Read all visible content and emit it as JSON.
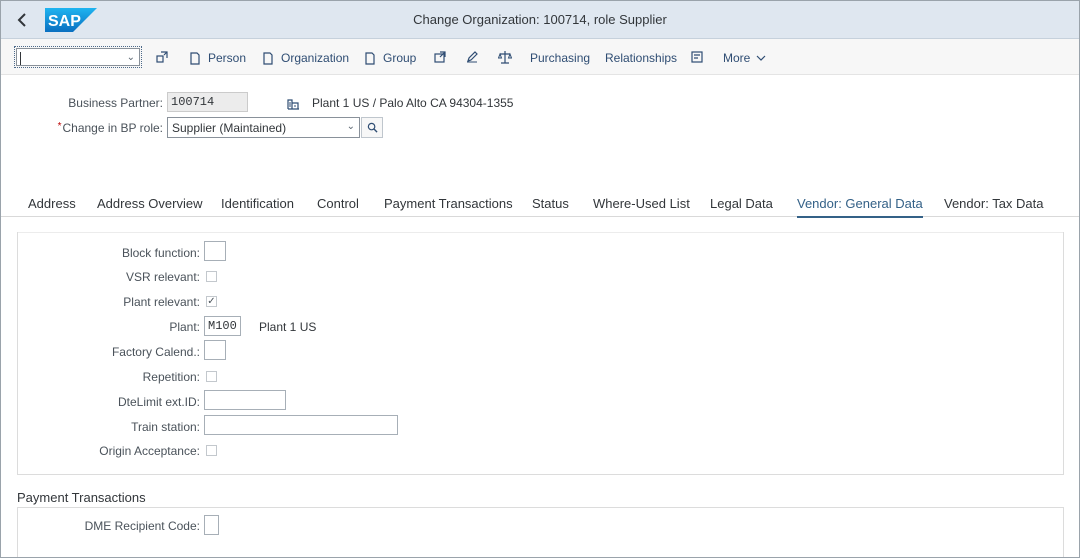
{
  "shell": {
    "title": "Change Organization: 100714, role Supplier",
    "logo_text": "SAP"
  },
  "toolbar": {
    "command_field_value": "",
    "items": {
      "person": "Person",
      "organization": "Organization",
      "group": "Group",
      "purchasing": "Purchasing",
      "relationships": "Relationships",
      "more": "More"
    }
  },
  "header": {
    "bp_label": "Business Partner:",
    "bp_value": "100714",
    "bp_desc": "Plant 1 US / Palo Alto CA 94304-1355",
    "role_label": "Change in BP role:",
    "role_value": "Supplier (Maintained)"
  },
  "tabs": [
    {
      "label": "Address"
    },
    {
      "label": "Address Overview"
    },
    {
      "label": "Identification"
    },
    {
      "label": "Control"
    },
    {
      "label": "Payment Transactions"
    },
    {
      "label": "Status"
    },
    {
      "label": "Where-Used List"
    },
    {
      "label": "Legal Data"
    },
    {
      "label": "Vendor: General Data",
      "active": true
    },
    {
      "label": "Vendor: Tax Data"
    }
  ],
  "fields": {
    "block_function": {
      "label": "Block function:",
      "value": ""
    },
    "vsr_relevant": {
      "label": "VSR relevant:",
      "checked": false
    },
    "plant_relevant": {
      "label": "Plant relevant:",
      "checked": true
    },
    "plant": {
      "label": "Plant:",
      "value": "M100",
      "desc": "Plant 1 US"
    },
    "factory_calendar": {
      "label": "Factory Calend.:",
      "value": ""
    },
    "repetition": {
      "label": "Repetition:",
      "checked": false
    },
    "dte_limit": {
      "label": "DteLimit ext.ID:",
      "value": ""
    },
    "train_station": {
      "label": "Train station:",
      "value": ""
    },
    "origin_acceptance": {
      "label": "Origin Acceptance:",
      "checked": false
    }
  },
  "payment_section": {
    "title": "Payment Transactions",
    "dme_label": "DME Recipient Code:",
    "dme_value": ""
  },
  "colors": {
    "shell_bg": "#dfe7f0",
    "link": "#2f4d73",
    "active_tab": "#346187",
    "required": "#bb0000"
  },
  "icons": {
    "back": "chevron-left-icon",
    "role_search": "search-icon",
    "bp_location": "building-icon",
    "check": "checkmark-glyph"
  }
}
